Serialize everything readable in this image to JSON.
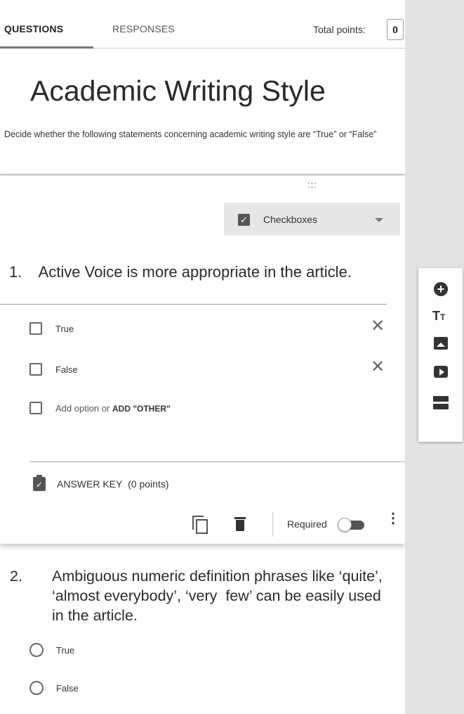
{
  "tabs": {
    "questions": "QUESTIONS",
    "responses": "RESPONSES"
  },
  "points": {
    "label": "Total points:",
    "value": "0"
  },
  "form": {
    "title": "Academic Writing Style",
    "description": "Decide whether the following statements concerning academic writing style are “True” or “False”"
  },
  "question1": {
    "type": "Checkboxes",
    "title": "1.    Active Voice is more appropriate in the article.",
    "options": [
      "True",
      "False"
    ],
    "add_option": "Add option",
    "or_text": "or",
    "add_other": "ADD \"OTHER\"",
    "answer_key": "ANSWER KEY  (0 points)",
    "required_label": "Required",
    "required": false
  },
  "question2": {
    "number": "2.",
    "title": "Ambiguous numeric definition phrases like ‘quite’, ‘almost everybody’, ‘very  few’ can be easily used in the article.",
    "options": [
      "True",
      "False"
    ]
  },
  "side_toolbar": {
    "icons": [
      "add-question-icon",
      "add-title-icon",
      "add-image-icon",
      "add-video-icon",
      "add-section-icon"
    ],
    "title_glyph": "T",
    "title_glyph_small": "T"
  },
  "icons": {
    "check": "✓",
    "close": "✕",
    "plus": "+",
    "more": "⋮",
    "drag": ":::"
  }
}
